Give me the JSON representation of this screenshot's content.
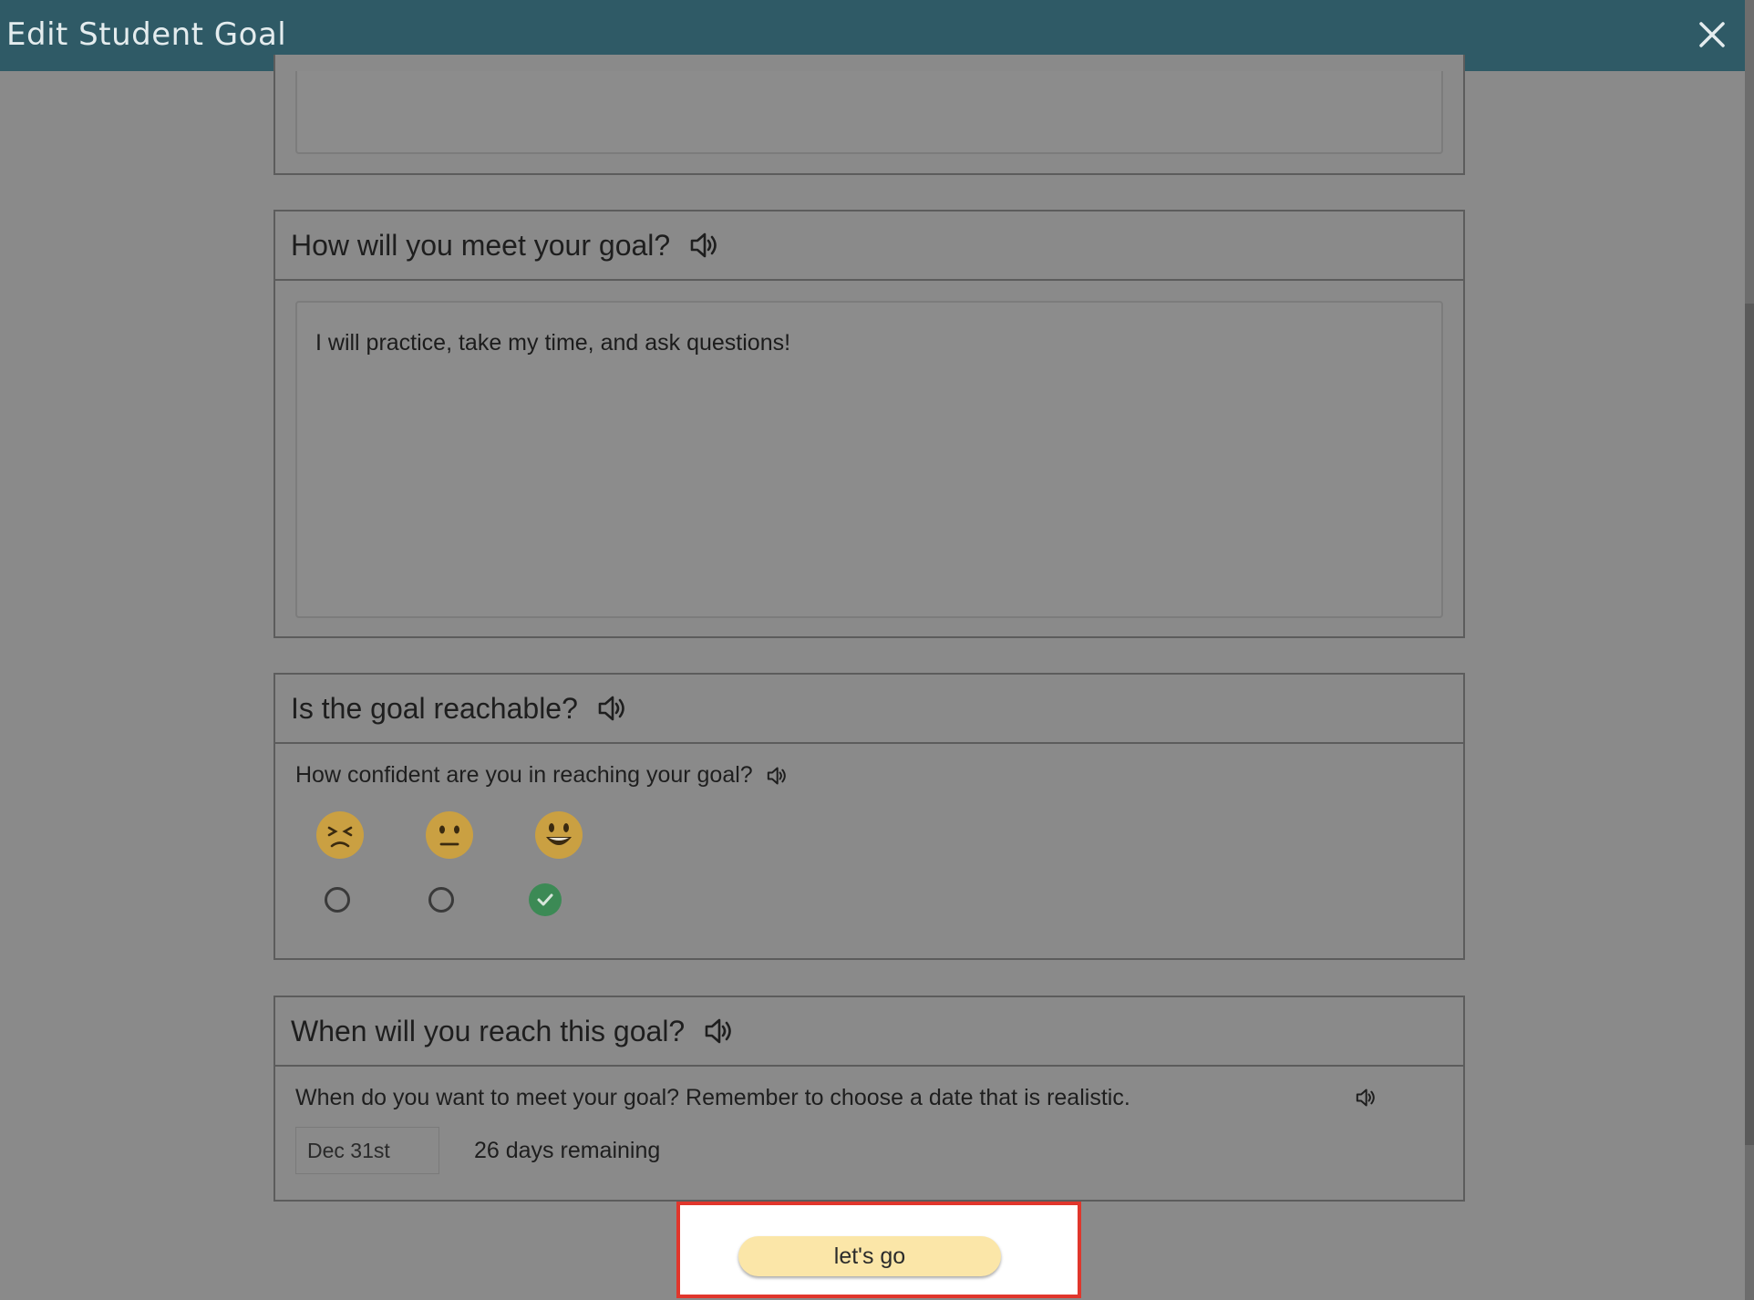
{
  "header": {
    "title": "Edit Student Goal",
    "close_icon": "close-icon"
  },
  "sections": {
    "how": {
      "title": "How will you meet your goal?",
      "answer": "I will practice, take my time, and ask questions!"
    },
    "reachable": {
      "title": "Is the goal reachable?",
      "question": "How confident are you in reaching your goal?",
      "options": [
        {
          "emoji": "😣",
          "icon": "frustrated-face-icon",
          "selected": false
        },
        {
          "emoji": "😐",
          "icon": "neutral-face-icon",
          "selected": false
        },
        {
          "emoji": "😃",
          "icon": "smiling-face-icon",
          "selected": true
        }
      ]
    },
    "when": {
      "title": "When will you reach this goal?",
      "question": "When do you want to meet your goal? Remember to choose a date that is realistic.",
      "date": "Dec 31st",
      "remaining": "26 days remaining"
    }
  },
  "footer": {
    "button_label": "let's go",
    "highlight_color": "#e0362c"
  },
  "colors": {
    "header": "#2f5a66",
    "button": "#fbe6a8",
    "check": "#3c8a55"
  }
}
